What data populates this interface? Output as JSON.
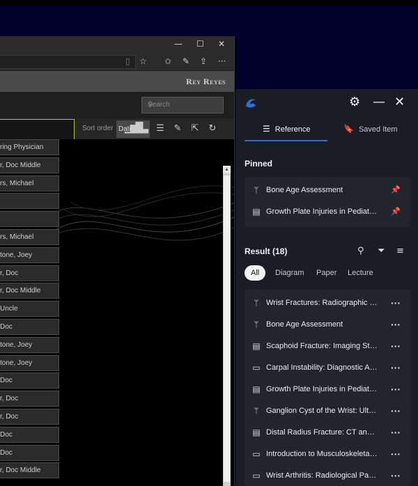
{
  "browser": {
    "window_controls": {
      "minimize": "—",
      "maximize": "☐",
      "close": "✕"
    },
    "toolbar_icons": [
      "reader-icon",
      "star-icon",
      "favorites-icon",
      "pen-icon",
      "share-icon",
      "more-icon"
    ],
    "user_name": "Rey Reyes",
    "search_placeholder": "Search",
    "sort_label": "Sort order",
    "sort_date_label": "Date",
    "list_rows": [
      "ring Physician",
      "r, Doc Middle",
      "rs, Michael",
      "",
      "",
      "rs, Michael",
      "tone, Joey",
      "r, Doc",
      "r, Doc Middle",
      "Uncle",
      "Doc",
      "tone, Joey",
      "tone, Joey",
      "Doc",
      "r, Doc",
      "r, Doc",
      "Doc",
      "Doc",
      "r, Doc Middle"
    ]
  },
  "panel": {
    "tabs": [
      {
        "label": "Reference",
        "icon": "list-icon",
        "active": true
      },
      {
        "label": "Saved Item",
        "icon": "bookmark-icon",
        "active": false
      }
    ],
    "pinned_title": "Pinned",
    "pinned": [
      {
        "label": "Bone Age Assessment",
        "icon": "diagram-icon"
      },
      {
        "label": "Growth Plate Injuries in Pediatrics",
        "icon": "paper-icon"
      }
    ],
    "result_title": "Result (18)",
    "filters": [
      "All",
      "Diagram",
      "Paper",
      "Lecture"
    ],
    "results": [
      {
        "label": "Wrist Fractures: Radiographic Ev...",
        "icon": "diagram-icon"
      },
      {
        "label": "Bone Age Assessment",
        "icon": "diagram-icon"
      },
      {
        "label": "Scaphoid Fracture: Imaging Stra...",
        "icon": "paper-icon"
      },
      {
        "label": "Carpal Instability: Diagnostic Ap...",
        "icon": "video-icon"
      },
      {
        "label": "Growth Plate Injuries in Pediatrics",
        "icon": "paper-icon"
      },
      {
        "label": "Ganglion Cyst of the Wrist: Ultra...",
        "icon": "diagram-icon"
      },
      {
        "label": "Distal Radius Fracture: CT and X...",
        "icon": "paper-icon"
      },
      {
        "label": "Introduction to Musculoskeletal...",
        "icon": "video-icon"
      },
      {
        "label": "Wrist Arthritis: Radiological Patt...",
        "icon": "video-icon"
      }
    ],
    "colors": {
      "panel_bg": "#1b1d24",
      "card_bg": "#22252d",
      "accent": "#2a6fd8"
    }
  }
}
